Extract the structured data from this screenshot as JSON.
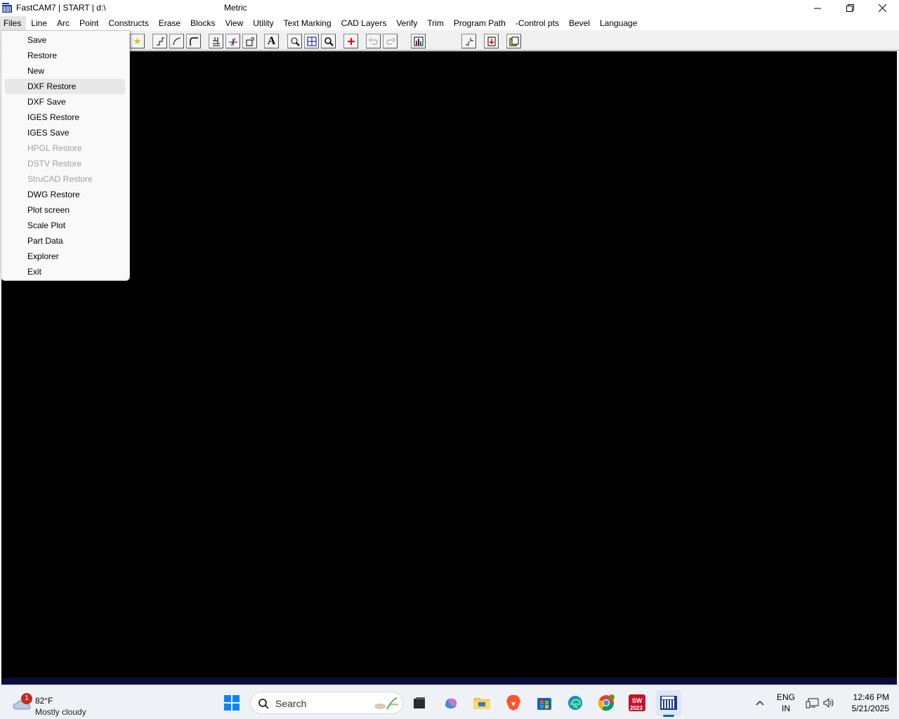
{
  "window": {
    "title_left": "FastCAM7 | START | d:\\",
    "title_center": "Metric",
    "minimize_icon": "minimize-icon",
    "maximize_icon": "restore-icon",
    "close_icon": "close-icon"
  },
  "menubar": {
    "items": [
      "Files",
      "Line",
      "Arc",
      "Point",
      "Constructs",
      "Erase",
      "Blocks",
      "View",
      "Utility",
      "Text Marking",
      "CAD Layers",
      "Verify",
      "Trim",
      "Program Path",
      "-Control pts",
      "Bevel",
      "Language"
    ]
  },
  "files_menu": {
    "items": [
      {
        "label": "Save",
        "enabled": true
      },
      {
        "label": "Restore",
        "enabled": true
      },
      {
        "label": "New",
        "enabled": true
      },
      {
        "label": "DXF Restore",
        "enabled": true,
        "highlighted": true
      },
      {
        "label": "DXF Save",
        "enabled": true
      },
      {
        "label": "IGES Restore",
        "enabled": true
      },
      {
        "label": "IGES Save",
        "enabled": true
      },
      {
        "label": "HPGL Restore",
        "enabled": false
      },
      {
        "label": "DSTV Restore",
        "enabled": false
      },
      {
        "label": "StruCAD Restore",
        "enabled": false
      },
      {
        "label": "DWG Restore",
        "enabled": true
      },
      {
        "label": "Plot screen",
        "enabled": true
      },
      {
        "label": "Scale Plot",
        "enabled": true
      },
      {
        "label": "Part Data",
        "enabled": true
      },
      {
        "label": "Explorer",
        "enabled": true
      },
      {
        "label": "Exit",
        "enabled": true
      }
    ]
  },
  "toolbar": {
    "buttons": [
      "star-icon",
      "line-step-icon",
      "arc-icon",
      "fillet-icon",
      "block-icon",
      "trim-icon",
      "rotate-icon",
      "text-icon",
      "zoom-window-icon",
      "zoom-fit-icon",
      "zoom-icon",
      "origin-cross-icon",
      "undo-icon",
      "redo-icon",
      "chart-icon",
      "path-icon",
      "import-icon",
      "folder-icon"
    ],
    "text_button_glyph": "A"
  },
  "taskbar": {
    "weather": {
      "temp": "82°F",
      "condition": "Mostly cloudy",
      "badge": "1"
    },
    "search_placeholder": "Search",
    "apps": [
      "start-icon",
      "file-manager-icon",
      "copilot-icon",
      "folder-icon",
      "brave-icon",
      "store-icon",
      "edge-icon",
      "chrome-icon",
      "solidworks-icon",
      "fastcam-icon"
    ],
    "solidworks_label": "2023",
    "language": "ENG",
    "region": "IN",
    "time": "12:46 PM",
    "date": "5/21/2025"
  },
  "colors": {
    "canvas": "#000000",
    "menu_bg": "#f9f9f9",
    "disabled_text": "#a0a0a0",
    "accent": "#0067c0"
  }
}
